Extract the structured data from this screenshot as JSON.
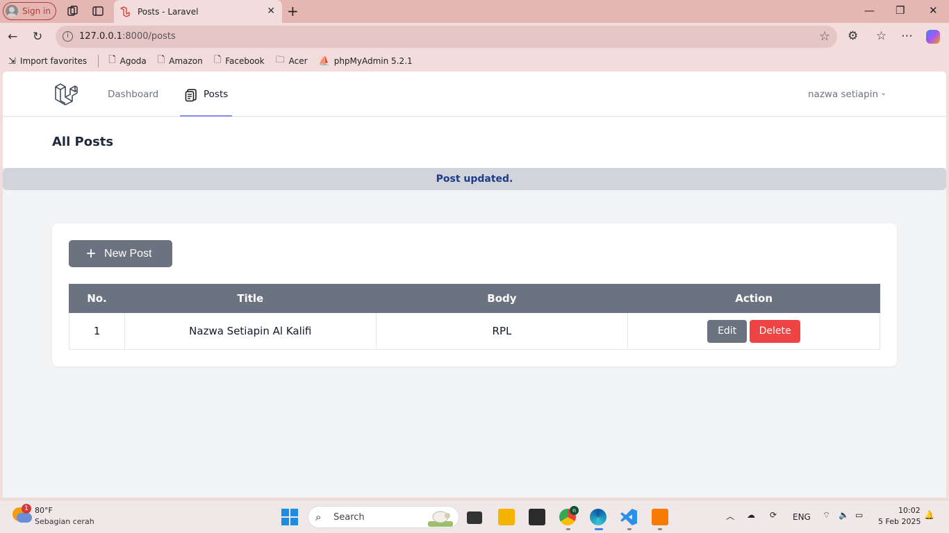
{
  "browser": {
    "signin_label": "Sign in",
    "tab_title": "Posts - Laravel",
    "url_host": "127.0.0.1",
    "url_rest": ":8000/posts",
    "bookmarks": [
      "Import favorites",
      "Agoda",
      "Amazon",
      "Facebook",
      "Acer",
      "phpMyAdmin 5.2.1"
    ]
  },
  "nav": {
    "dashboard": "Dashboard",
    "posts": "Posts",
    "user": "nazwa setiapin"
  },
  "header": {
    "title": "All Posts"
  },
  "flash": "Post updated.",
  "content": {
    "new_post_label": "New Post",
    "table": {
      "headers": [
        "No.",
        "Title",
        "Body",
        "Action"
      ],
      "rows": [
        {
          "no": "1",
          "title": "Nazwa Setiapin Al Kalifi",
          "body": "RPL",
          "edit": "Edit",
          "delete": "Delete"
        }
      ]
    }
  },
  "taskbar": {
    "temp": "80°F",
    "weather": "Sebagian cerah",
    "weather_badge": "1",
    "search": "Search",
    "lang": "ENG",
    "time": "10:02",
    "date": "5 Feb 2025",
    "chrome_badge": "n"
  },
  "colors": {
    "accent": "#818cf8",
    "button_gray": "#6b7280",
    "delete_red": "#ef4444",
    "flash_text": "#1e3a8a"
  }
}
